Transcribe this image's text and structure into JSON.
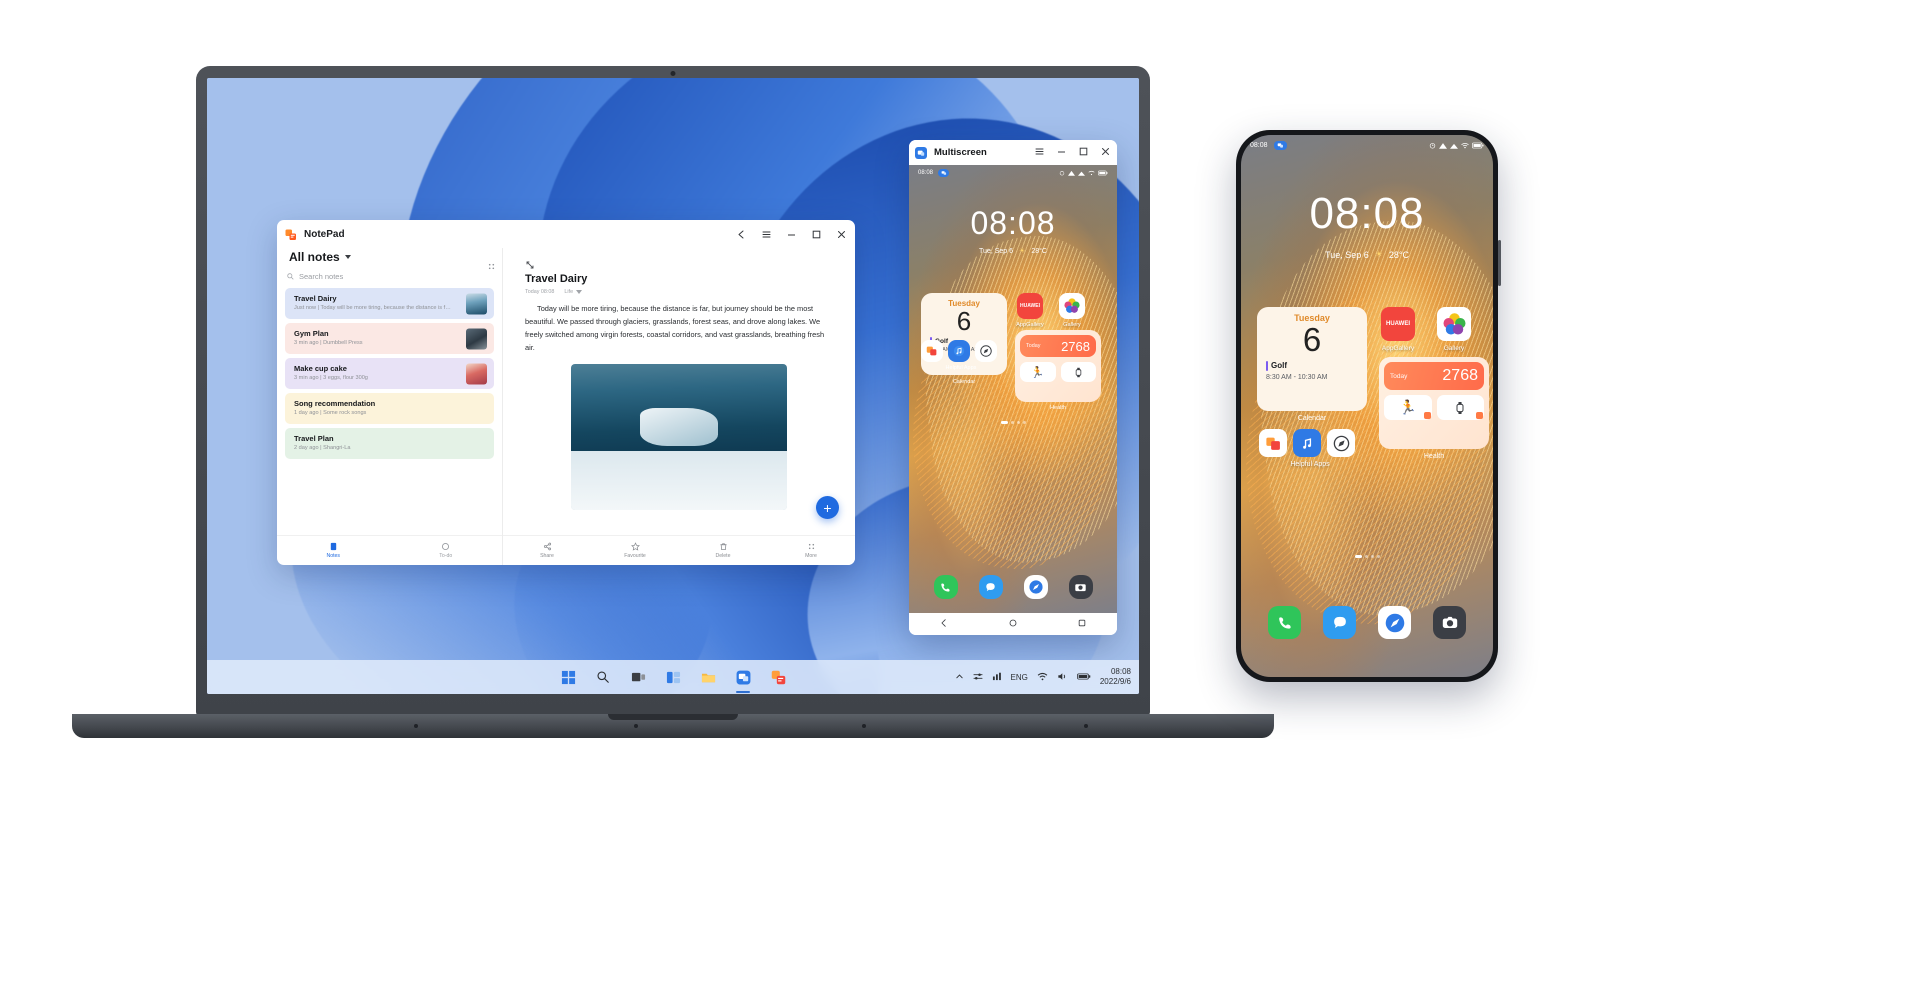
{
  "scene": {
    "description": "Huawei Multiscreen collaboration: laptop mirroring a phone, with a physical phone beside it"
  },
  "laptop": {
    "notepad": {
      "app_title": "NotePad",
      "app_icon": "notepad-icon",
      "header_filter": "All notes",
      "search_placeholder": "Search notes",
      "window_controls": {
        "back": "back-icon",
        "menu": "menu-icon",
        "minimize": "minimize-icon",
        "maximize": "maximize-icon",
        "close": "close-icon"
      },
      "grid_icon": "grid-icon",
      "add_button": "+",
      "notes": [
        {
          "title": "Travel Dairy",
          "meta": "Just now | Today will be more tiring, because the distance is far, but...",
          "color": "#dce4f7",
          "thumb": "glacier"
        },
        {
          "title": "Gym Plan",
          "meta": "3 min ago | Dumbbell Press",
          "color": "#fbe8e4",
          "thumb": "gym"
        },
        {
          "title": "Make cup cake",
          "meta": "3 min ago | 3 eggs,  flour 300g",
          "color": "#e8e2f6",
          "thumb": "cake"
        },
        {
          "title": "Song recommendation",
          "meta": "1 day ago | Some rock songs",
          "color": "#fcf3da",
          "thumb": "none"
        },
        {
          "title": "Travel Plan",
          "meta": "2 day ago | Shangri-La",
          "color": "#e4f2e6",
          "thumb": "none"
        }
      ],
      "left_tabs": [
        {
          "label": "Notes",
          "icon": "notes-icon",
          "active": true
        },
        {
          "label": "To-do",
          "icon": "todo-icon",
          "active": false
        }
      ],
      "editor": {
        "expand_icon": "expand-icon",
        "title": "Travel Dairy",
        "date": "Today 08:08",
        "category": "Life",
        "body": "Today will be more tiring, because  the distance is far, but journey should be the most beautiful. We passed through glaciers, grasslands, forest seas, and drove along lakes. We freely switched among virgin forests, coastal corridors, and vast grasslands, breathing fresh air.",
        "image_alt": "iceberg-in-glacier-lake"
      },
      "bottom_actions": [
        {
          "label": "Share",
          "icon": "share-icon"
        },
        {
          "label": "Favourite",
          "icon": "star-icon"
        },
        {
          "label": "Delete",
          "icon": "trash-icon"
        },
        {
          "label": "More",
          "icon": "more-icon"
        }
      ]
    },
    "multiscreen": {
      "title": "Multiscreen",
      "icon": "multiscreen-icon",
      "window_controls": {
        "menu": "menu-icon",
        "minimize": "minimize-icon",
        "maximize": "maximize-icon",
        "close": "close-icon"
      },
      "nav": [
        {
          "name": "back-nav-icon"
        },
        {
          "name": "home-nav-icon"
        },
        {
          "name": "recents-nav-icon"
        }
      ]
    },
    "taskbar": {
      "icons": [
        {
          "name": "start-windows-icon"
        },
        {
          "name": "search-icon"
        },
        {
          "name": "task-view-icon"
        },
        {
          "name": "widgets-icon"
        },
        {
          "name": "file-explorer-icon"
        },
        {
          "name": "multiscreen-taskbar-icon"
        },
        {
          "name": "notepad-taskbar-icon"
        }
      ],
      "tray": [
        {
          "name": "chevron-up-icon"
        },
        {
          "name": "network-settings-icon"
        },
        {
          "name": "stats-icon"
        }
      ],
      "language": "ENG",
      "tray_icons": [
        {
          "name": "wifi-icon"
        },
        {
          "name": "volume-icon"
        },
        {
          "name": "battery-icon"
        }
      ],
      "time": "08:08",
      "date": "2022/9/6"
    }
  },
  "phone": {
    "status_bar": {
      "time": "08:08",
      "left_icon": "multiscreen-status-icon",
      "right_icons": [
        "alarm-icon",
        "signal-icon",
        "signal2-icon",
        "wifi-icon",
        "battery-icon"
      ]
    },
    "lock_clock": {
      "time": "08:08",
      "date": "Tue, Sep 6",
      "weather_icon": "sun-icon",
      "temperature": "28°C"
    },
    "calendar_widget": {
      "weekday": "Tuesday",
      "day": "6",
      "event": "Golf",
      "event_time": "8:30 AM - 10:30 AM",
      "label": "Calendar"
    },
    "apps": [
      {
        "label": "AppGallery",
        "icon": "appgallery-icon"
      },
      {
        "label": "Gallery",
        "icon": "gallery-icon"
      }
    ],
    "health_widget": {
      "today_label": "Today",
      "steps": "2768",
      "steps_icon": "walking-icon",
      "chips": [
        {
          "icon": "running-icon"
        },
        {
          "icon": "watch-icon"
        }
      ],
      "label": "Health"
    },
    "useful_apps_label": "Helpful Apps",
    "useful_apps": [
      {
        "icon": "files-icon"
      },
      {
        "icon": "music-icon"
      },
      {
        "icon": "compass-icon"
      }
    ],
    "dock": [
      {
        "icon": "phone-icon",
        "color": "#2fc55a"
      },
      {
        "icon": "messages-icon",
        "color": "#2f9cf0"
      },
      {
        "icon": "browser-icon",
        "color": "#3a7df5"
      },
      {
        "icon": "camera-icon",
        "color": "#3b3e45"
      }
    ],
    "page_dots": 4,
    "active_dot": 1,
    "nav": [
      {
        "name": "back-nav-icon"
      },
      {
        "name": "home-nav-icon"
      },
      {
        "name": "recents-nav-icon"
      }
    ]
  },
  "colors": {
    "accent_blue": "#1f6ae0",
    "taskbar": "#dee9fa",
    "steps_orange": "#ff7a4d",
    "calendar_cream": "#fdf4e8"
  }
}
